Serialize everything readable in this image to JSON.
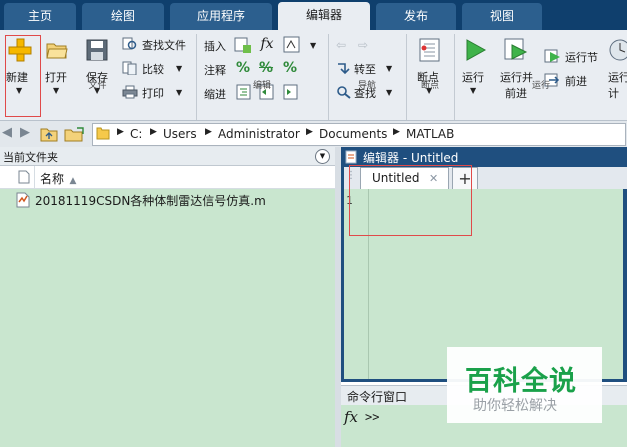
{
  "tabs": [
    {
      "label": "主页",
      "active": false
    },
    {
      "label": "绘图",
      "active": false
    },
    {
      "label": "应用程序",
      "active": false
    },
    {
      "label": "编辑器",
      "active": true
    },
    {
      "label": "发布",
      "active": false
    },
    {
      "label": "视图",
      "active": false
    }
  ],
  "ribbon": {
    "file_group": {
      "label": "文件",
      "new": "新建",
      "open": "打开",
      "save": "保存",
      "find_files": "查找文件",
      "compare": "比较",
      "print": "打印"
    },
    "edit_group": {
      "label": "编辑",
      "insert": "插入",
      "comment": "注释",
      "indent": "缩进",
      "fx": "fx"
    },
    "nav_group": {
      "label": "导航",
      "goto": "转至",
      "find": "查找"
    },
    "breakpoint_group": {
      "label": "断点",
      "breakpoints": "断点"
    },
    "run_group": {
      "label": "运行",
      "run": "运行",
      "run_advance_line1": "运行并",
      "run_advance_line2": "前进",
      "run_section": "运行节",
      "advance": "前进",
      "run_time_line1": "运行",
      "run_time_line2": "计"
    }
  },
  "address": {
    "crumbs": [
      "C:",
      "Users",
      "Administrator",
      "Documents",
      "MATLAB"
    ]
  },
  "file_browser": {
    "title": "当前文件夹",
    "column_name": "名称",
    "sort_indicator": "▲",
    "files": [
      "20181119CSDN各种体制雷达信号仿真.m"
    ]
  },
  "editor": {
    "title": "编辑器 - Untitled",
    "tab_label": "Untitled",
    "close_glyph": "✕",
    "add_glyph": "+",
    "line_number": "1"
  },
  "command_window": {
    "title": "命令行窗口",
    "fx": "fx",
    "prompt": ">>"
  },
  "watermark": {
    "line1": "百科全说",
    "line2": "助你轻松解决"
  },
  "colors": {
    "accent_green_text": "#1aa14a",
    "highlight_red": "#e04a4a",
    "panel_green": "#c9e6cf",
    "tab_dark": "#0f3f6d"
  }
}
